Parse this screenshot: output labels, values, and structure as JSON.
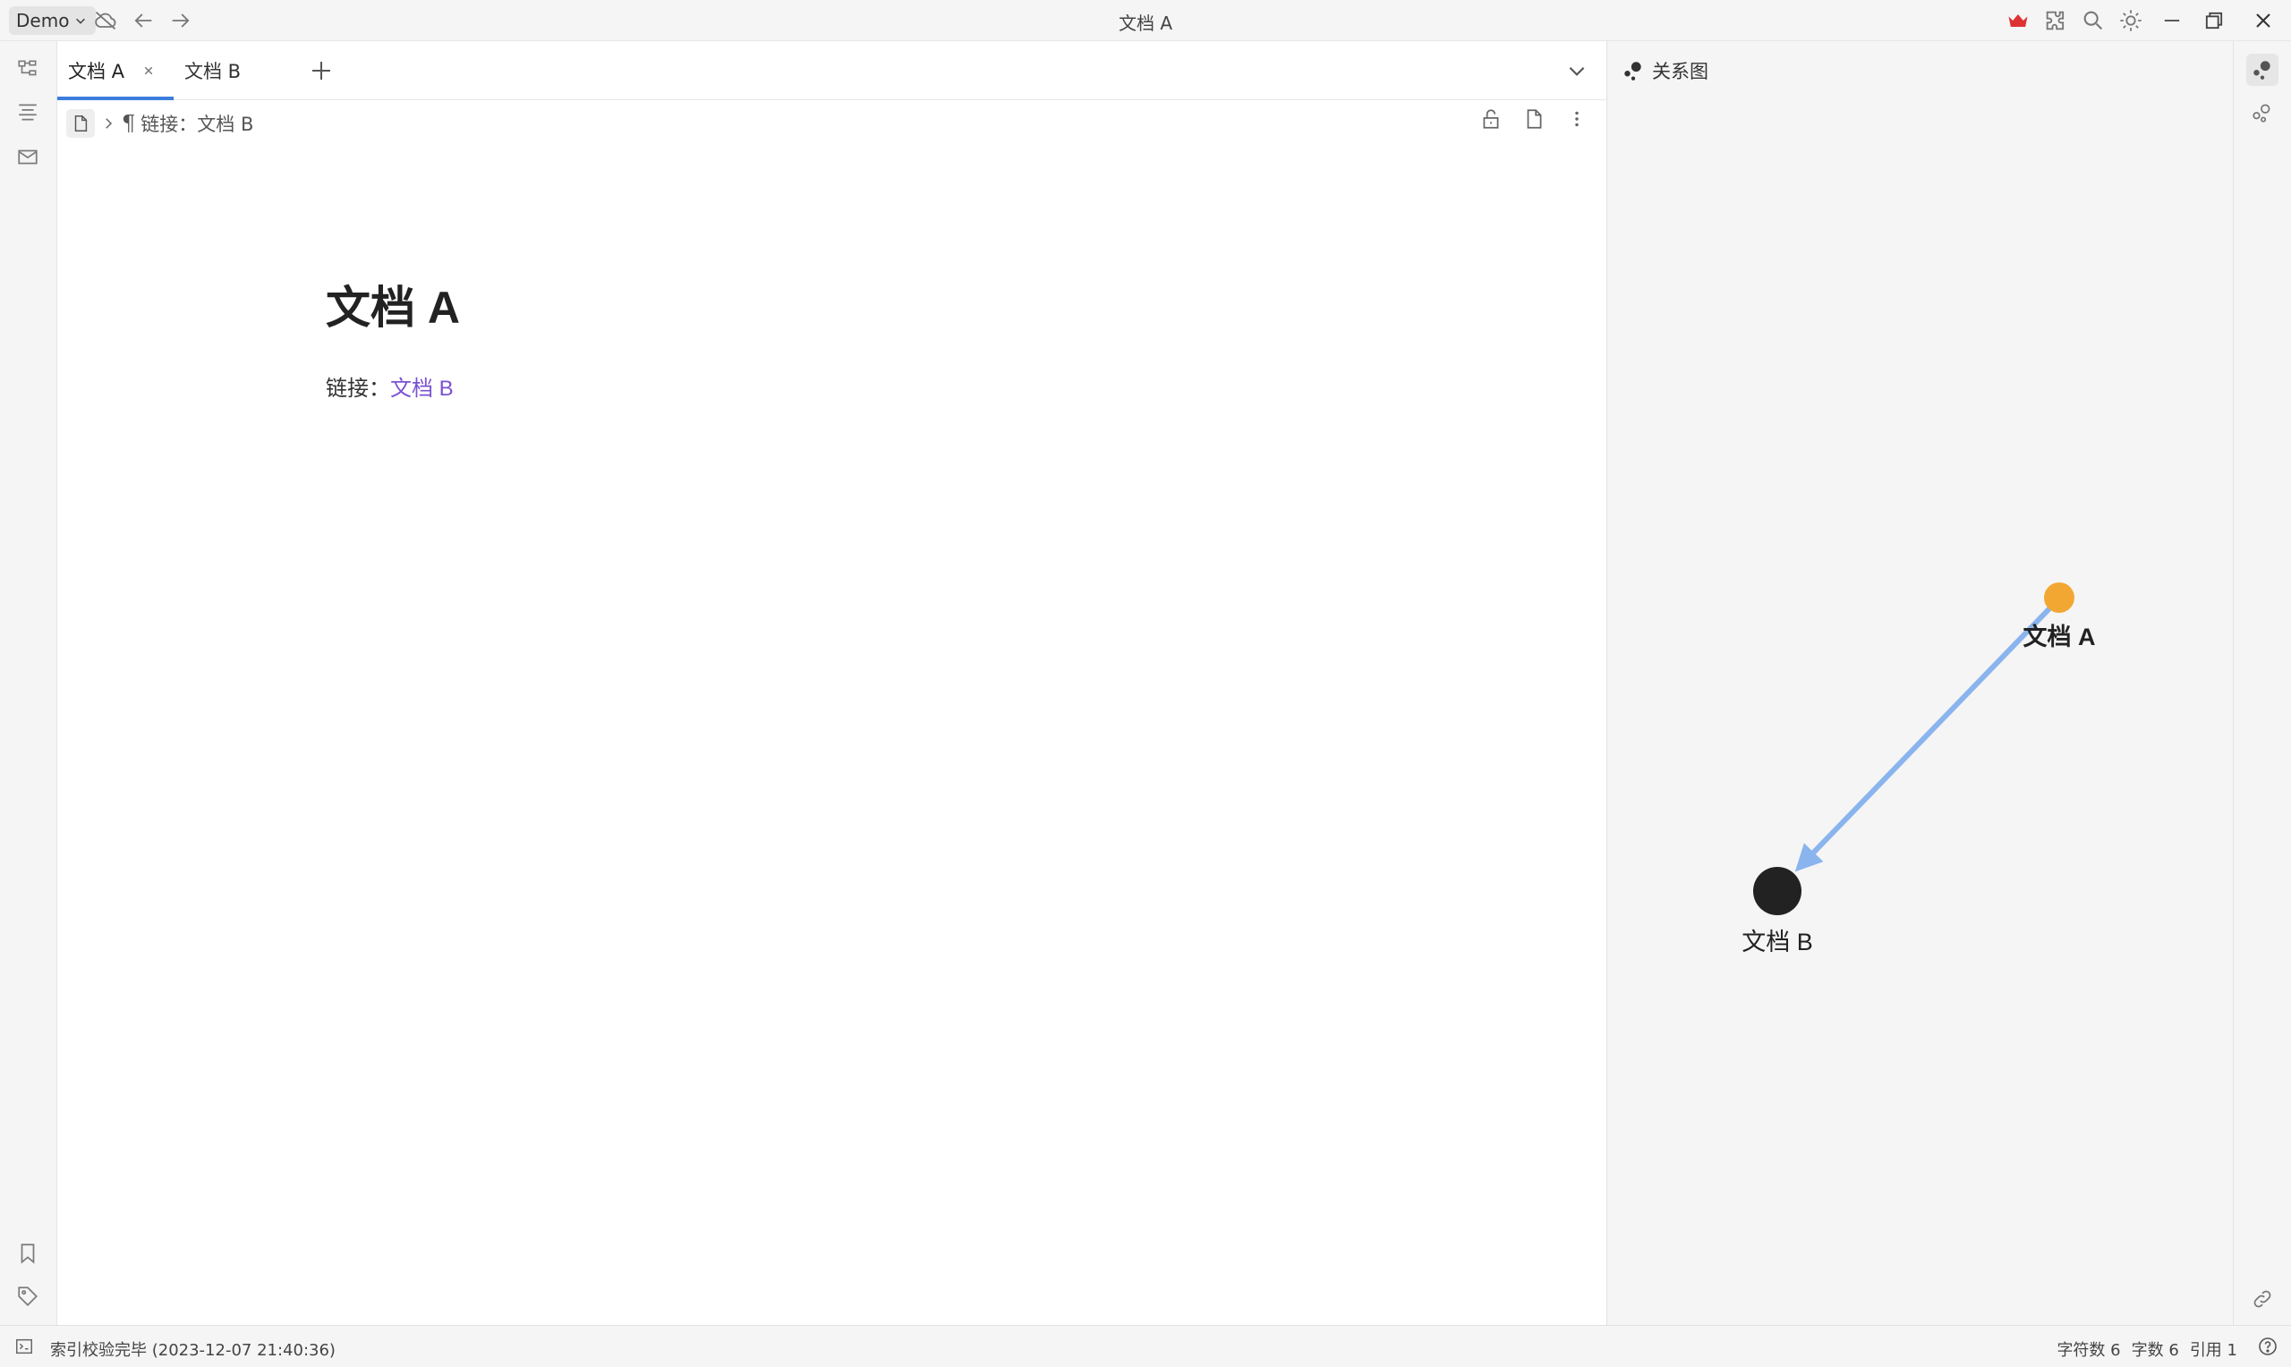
{
  "window": {
    "title": "文档 A",
    "workspace": "Demo"
  },
  "tabs": [
    {
      "label": "文档 A",
      "active": true
    },
    {
      "label": "文档 B",
      "active": false
    }
  ],
  "breadcrumb": {
    "item": "链接：文档 B"
  },
  "document": {
    "title": "文档 A",
    "para_prefix": "链接：",
    "link_text": "文档 B"
  },
  "graph": {
    "header": "关系图",
    "nodes": [
      {
        "id": "a",
        "label": "文档 A",
        "color": "#f3a733",
        "current": true
      },
      {
        "id": "b",
        "label": "文档 B",
        "color": "#222222",
        "current": false
      }
    ],
    "edge_color": "#8ab4ee"
  },
  "status": {
    "message": "索引校验完毕 (2023-12-07 21:40:36)",
    "chars": "字符数 6",
    "words": "字数 6",
    "refs": "引用 1"
  }
}
